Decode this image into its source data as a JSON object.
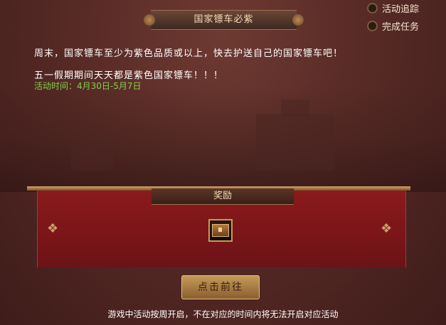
{
  "header": {
    "title": "国家镖车必紫"
  },
  "sidebar": {
    "track_label": "活动追踪",
    "tasks_label": "完成任务"
  },
  "content": {
    "line1": "周末，国家镖车至少为紫色品质或以上，快去护送自己的国家镖车吧！",
    "line2": "五一假期期间天天都是紫色国家镖车！！！",
    "time": "活动时间：4月30日-5月7日"
  },
  "reward": {
    "title": "奖励",
    "item": "chest-icon"
  },
  "actions": {
    "go_label": "点击前往"
  },
  "footer": {
    "note": "游戏中活动按周开启，不在对应的时间内将无法开启对应活动"
  },
  "colors": {
    "accent_green": "#7fd247",
    "panel_red": "#7a1518",
    "gold": "#c49a5a"
  }
}
